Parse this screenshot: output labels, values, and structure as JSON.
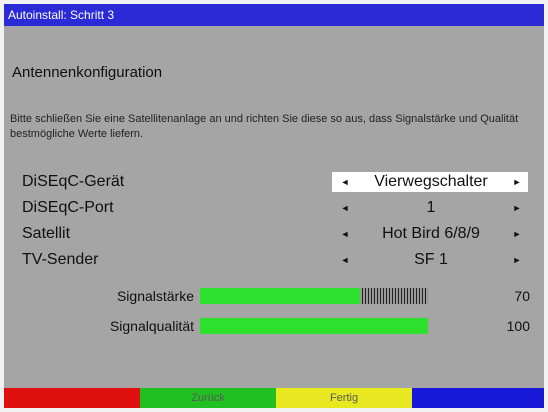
{
  "title": "Autoinstall: Schritt 3",
  "heading": "Antennenkonfiguration",
  "info_text": "Bitte schließen Sie eine Satellitenanlage an und richten Sie diese so aus, dass Signalstärke und Qualität bestmögliche Werte liefern.",
  "arrows": {
    "left": "◄",
    "right": "►"
  },
  "settings": [
    {
      "label": "DiSEqC-Gerät",
      "value": "Vierwegschalter",
      "active": true
    },
    {
      "label": "DiSEqC-Port",
      "value": "1",
      "active": false
    },
    {
      "label": "Satellit",
      "value": "Hot Bird 6/8/9",
      "active": false
    },
    {
      "label": "TV-Sender",
      "value": "SF 1",
      "active": false
    }
  ],
  "meters": [
    {
      "label": "Signalstärke",
      "value": "70",
      "fill_percent": 70
    },
    {
      "label": "Signalqualität",
      "value": "100",
      "fill_percent": 100
    }
  ],
  "colors": {
    "title_bar": "#2a2ad6",
    "background": "#a5a5a5",
    "bar_fill": "#2de02d"
  },
  "buttons": [
    {
      "name": "red-button",
      "label": "",
      "color": "#e01010"
    },
    {
      "name": "green-button",
      "label": "Zurück",
      "color": "#20c020"
    },
    {
      "name": "yellow-button",
      "label": "Fertig",
      "color": "#e8e820"
    },
    {
      "name": "blue-button",
      "label": "",
      "color": "#1818d8"
    }
  ]
}
